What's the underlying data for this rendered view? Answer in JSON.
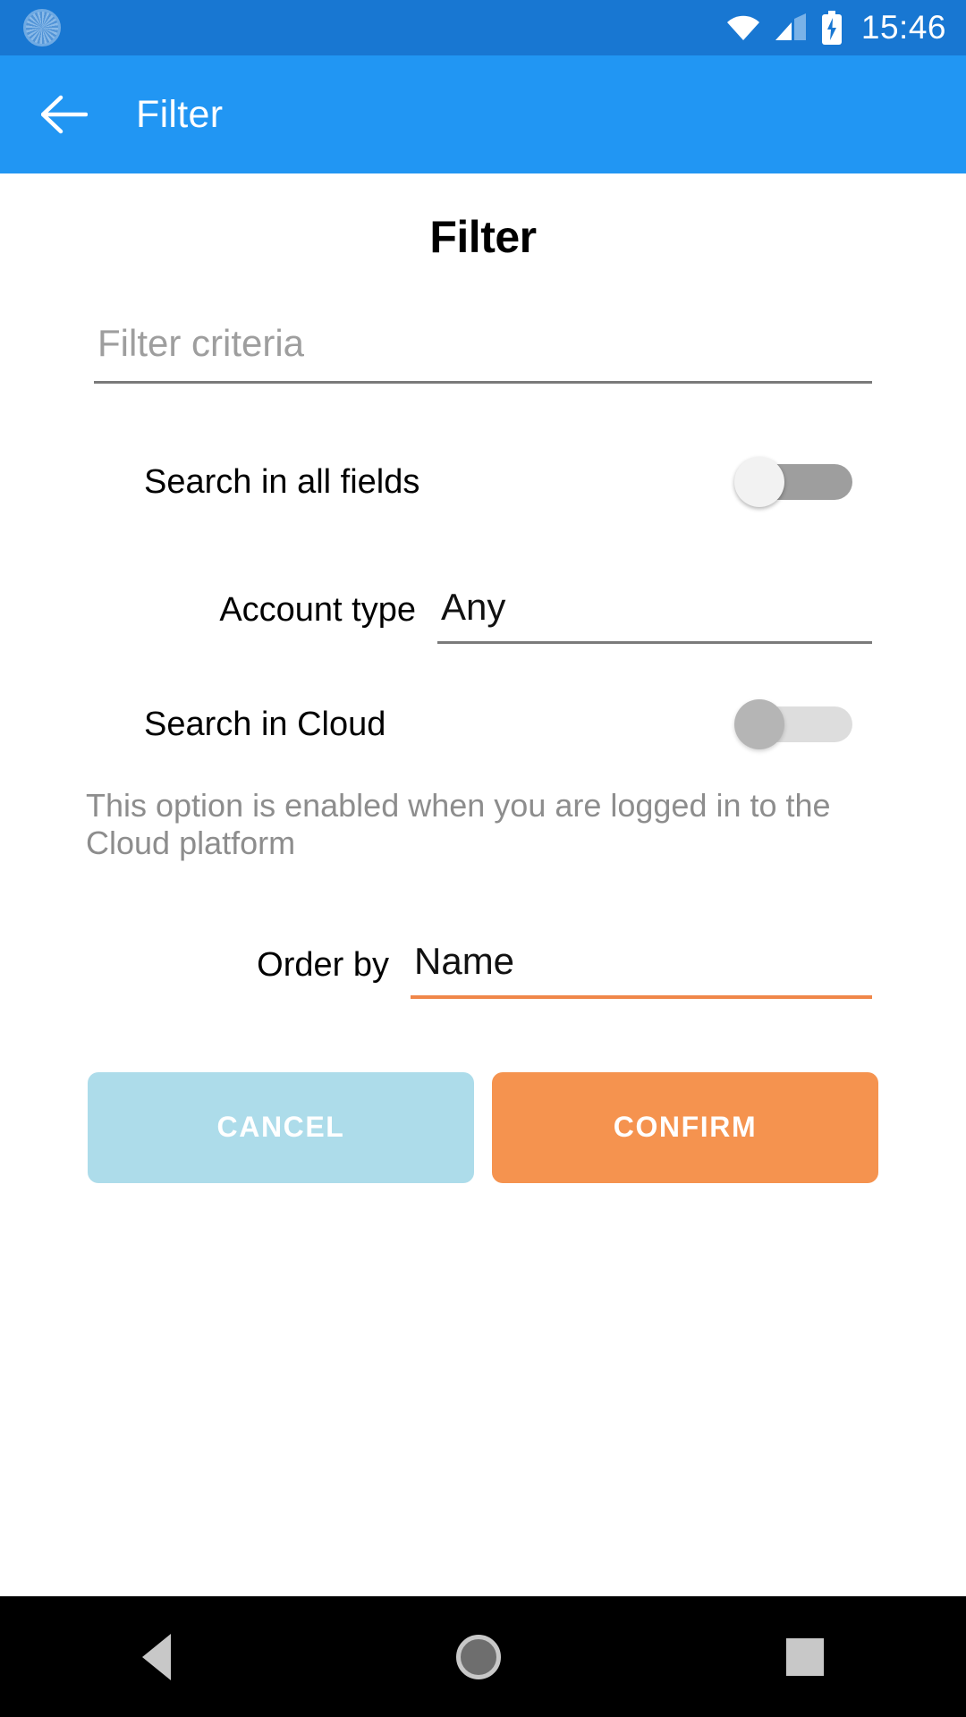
{
  "statusbar": {
    "clock": "15:46",
    "icons": [
      "settings-spinner-icon",
      "wifi-icon",
      "cellular-signal-icon",
      "battery-charging-icon"
    ],
    "background_color": "#1877D2"
  },
  "appbar": {
    "back_icon": "arrow-back-icon",
    "title": "Filter",
    "background_color": "#2196F3"
  },
  "main": {
    "page_title": "Filter",
    "criteria": {
      "value": "",
      "placeholder": "Filter criteria"
    },
    "search_all_fields": {
      "label": "Search in all fields",
      "state": "off"
    },
    "account_type": {
      "label": "Account type",
      "value": "Any"
    },
    "search_in_cloud": {
      "label": "Search in Cloud",
      "state": "off-disabled"
    },
    "cloud_hint": "This option is enabled when you are logged in to the Cloud platform",
    "order_by": {
      "label": "Order by",
      "value": "Name",
      "underline_color": "#F0874A"
    },
    "buttons": {
      "cancel": "CANCEL",
      "confirm": "CONFIRM",
      "cancel_color": "#ADDCEA",
      "confirm_color": "#F5934F"
    }
  },
  "navbar": {
    "back": "nav-back-icon",
    "home": "nav-home-icon",
    "recents": "nav-recents-icon"
  }
}
